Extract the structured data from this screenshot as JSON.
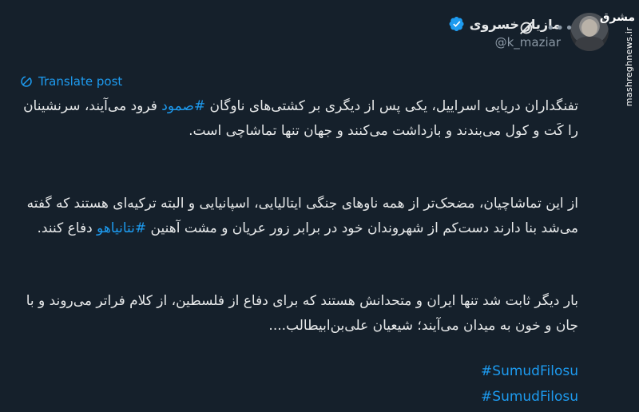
{
  "user": {
    "display_name": "مازیار خسروی",
    "handle": "@k_maziar"
  },
  "actions": {
    "grok_icon": "grok-icon",
    "more_label": "•••"
  },
  "translate": {
    "label": "Translate post"
  },
  "post": {
    "p1_before": "تفنگداران دریایی اسراییل، یکی پس از دیگری بر کشتی‌های ناوگان ",
    "p1_hashtag": "#صمود",
    "p1_after": " فرود می‌آیند، سرنشینان را کَت و کول می‌بندند و بازداشت می‌کنند و جهان تنها تماشاچی است.",
    "p2_before": "از این تماشاچیان، مضحک‌تر از همه ناوهای جنگی ایتالیایی، اسپانیایی و البته ترکیه‌ای هستند که گفته می‌شد بنا دارند دست‌کم از شهروندان خود در برابر زور عریان و مشت آهنین ",
    "p2_hashtag": "#نتانیاهو",
    "p2_after": " دفاع کنند.",
    "p3": "بار دیگر ثابت شد تنها ایران و متحدانش هستند که برای دفاع از فلسطین، از کلام فراتر می‌روند و با جان و خون به میدان می‌آیند؛ شیعیان علی‌بن‌ابیطالب....",
    "tags": [
      "#SumudFilosu",
      "#SumudFilosu"
    ]
  },
  "watermark": {
    "logo": "مشرق",
    "site": "mashreghnews.ir"
  },
  "colors": {
    "background": "#15202b",
    "text": "#e7e9ea",
    "accent": "#1d9bf0",
    "muted": "#8b98a5"
  }
}
